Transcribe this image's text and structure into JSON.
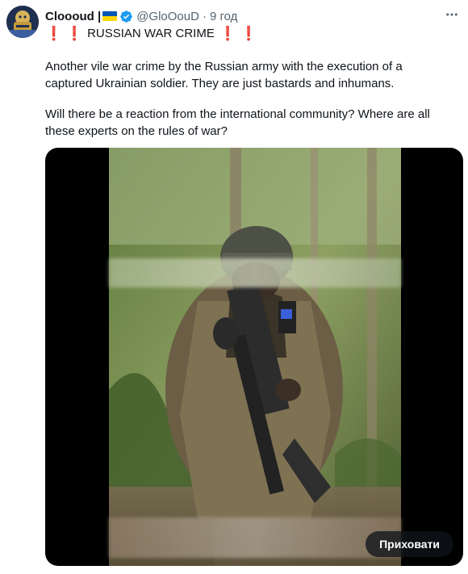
{
  "author": {
    "name": "Cloooud |",
    "handle": "@GloOouD",
    "separator": "·",
    "time": "9 год"
  },
  "tweet": {
    "headline": "RUSSIAN WAR CRIME",
    "headline_marks": "❗ ❗",
    "headline_marks_after": "❗ ❗",
    "paragraph1": "Another vile war crime by the Russian army with the execution of a captured Ukrainian soldier. They are just bastards and inhumans.",
    "paragraph2": "Will there be a reaction from the international community? Where are all these experts on the rules of war?"
  },
  "media": {
    "hide_label": "Приховати"
  },
  "icons": {
    "more": "more-horizontal-icon",
    "verified": "verified-badge-icon",
    "flag": "ukraine-flag-icon"
  },
  "colors": {
    "text": "#0f1419",
    "secondary": "#536471",
    "verified": "#1d9bf0",
    "alert": "#d0021b",
    "flag_blue": "#0057b7",
    "flag_yellow": "#ffd700"
  }
}
